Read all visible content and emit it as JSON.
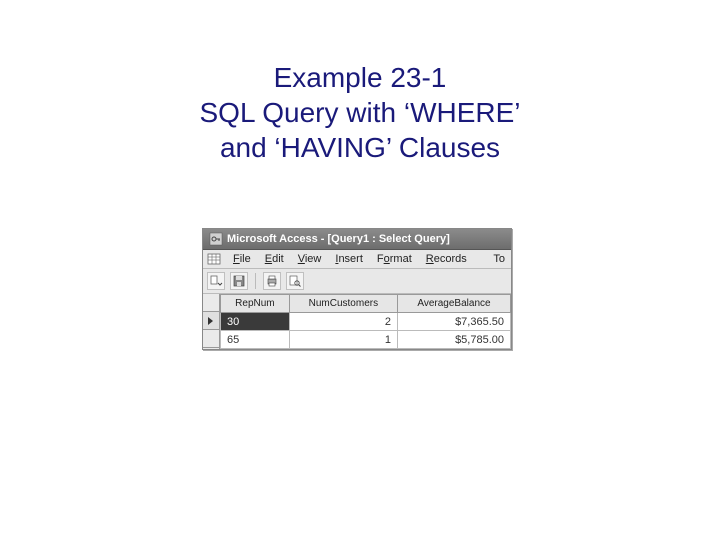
{
  "title": {
    "line1": "Example 23-1",
    "line2": "SQL Query with ‘WHERE’",
    "line3": "and ‘HAVING’ Clauses"
  },
  "window": {
    "app_name": "Microsoft Access",
    "doc_title": "[Query1 : Select Query]"
  },
  "menu": {
    "file": "File",
    "edit": "Edit",
    "view": "View",
    "insert": "Insert",
    "format": "Format",
    "records": "Records",
    "tools_abbrev": "To"
  },
  "columns": {
    "repnum": "RepNum",
    "numcust": "NumCustomers",
    "avgbal": "AverageBalance"
  },
  "rows": [
    {
      "repnum": "30",
      "numcust": "2",
      "avgbal": "$7,365.50",
      "selected": true
    },
    {
      "repnum": "65",
      "numcust": "1",
      "avgbal": "$5,785.00",
      "selected": false
    }
  ]
}
